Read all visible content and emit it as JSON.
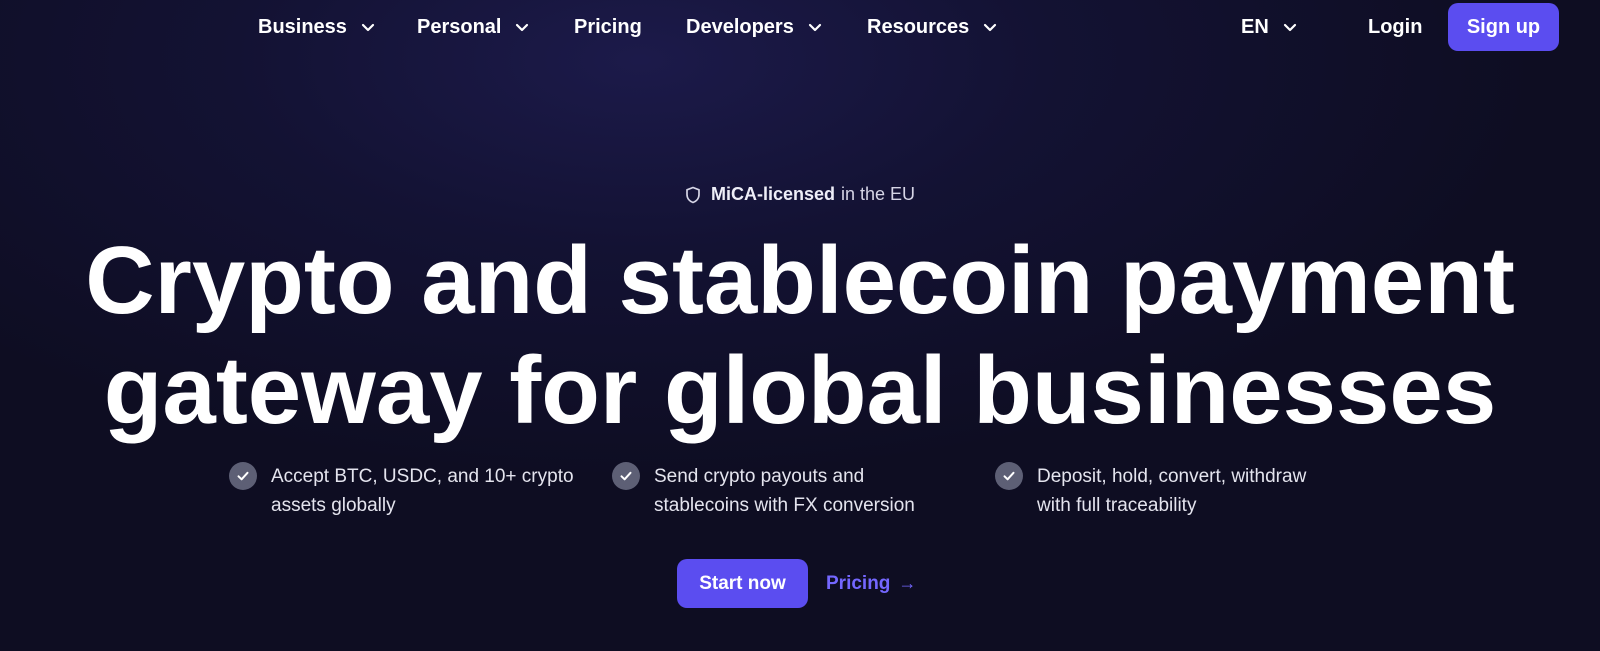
{
  "nav": {
    "business": "Business",
    "personal": "Personal",
    "pricing": "Pricing",
    "developers": "Developers",
    "resources": "Resources",
    "language": "EN",
    "login": "Login",
    "signup": "Sign up"
  },
  "hero": {
    "badge_bold": "MiCA-licensed",
    "badge_rest": "in the EU",
    "headline_line1": "Crypto and stablecoin payment",
    "headline_line2": "gateway for global businesses",
    "features": [
      {
        "line1": "Accept BTC, USDC, and 10+ crypto",
        "line2": "assets globally"
      },
      {
        "line1": "Send crypto payouts and",
        "line2": "stablecoins with FX conversion"
      },
      {
        "line1": "Deposit, hold, convert, withdraw",
        "line2": "with full traceability"
      }
    ],
    "start_button": "Start now",
    "pricing_link": "Pricing",
    "pricing_arrow": "→"
  },
  "colors": {
    "accent": "#5b4df0",
    "link": "#7467ff",
    "background": "#131233"
  },
  "icons": [
    "chevron-down-icon",
    "shield-icon",
    "check-icon",
    "arrow-right-icon"
  ]
}
